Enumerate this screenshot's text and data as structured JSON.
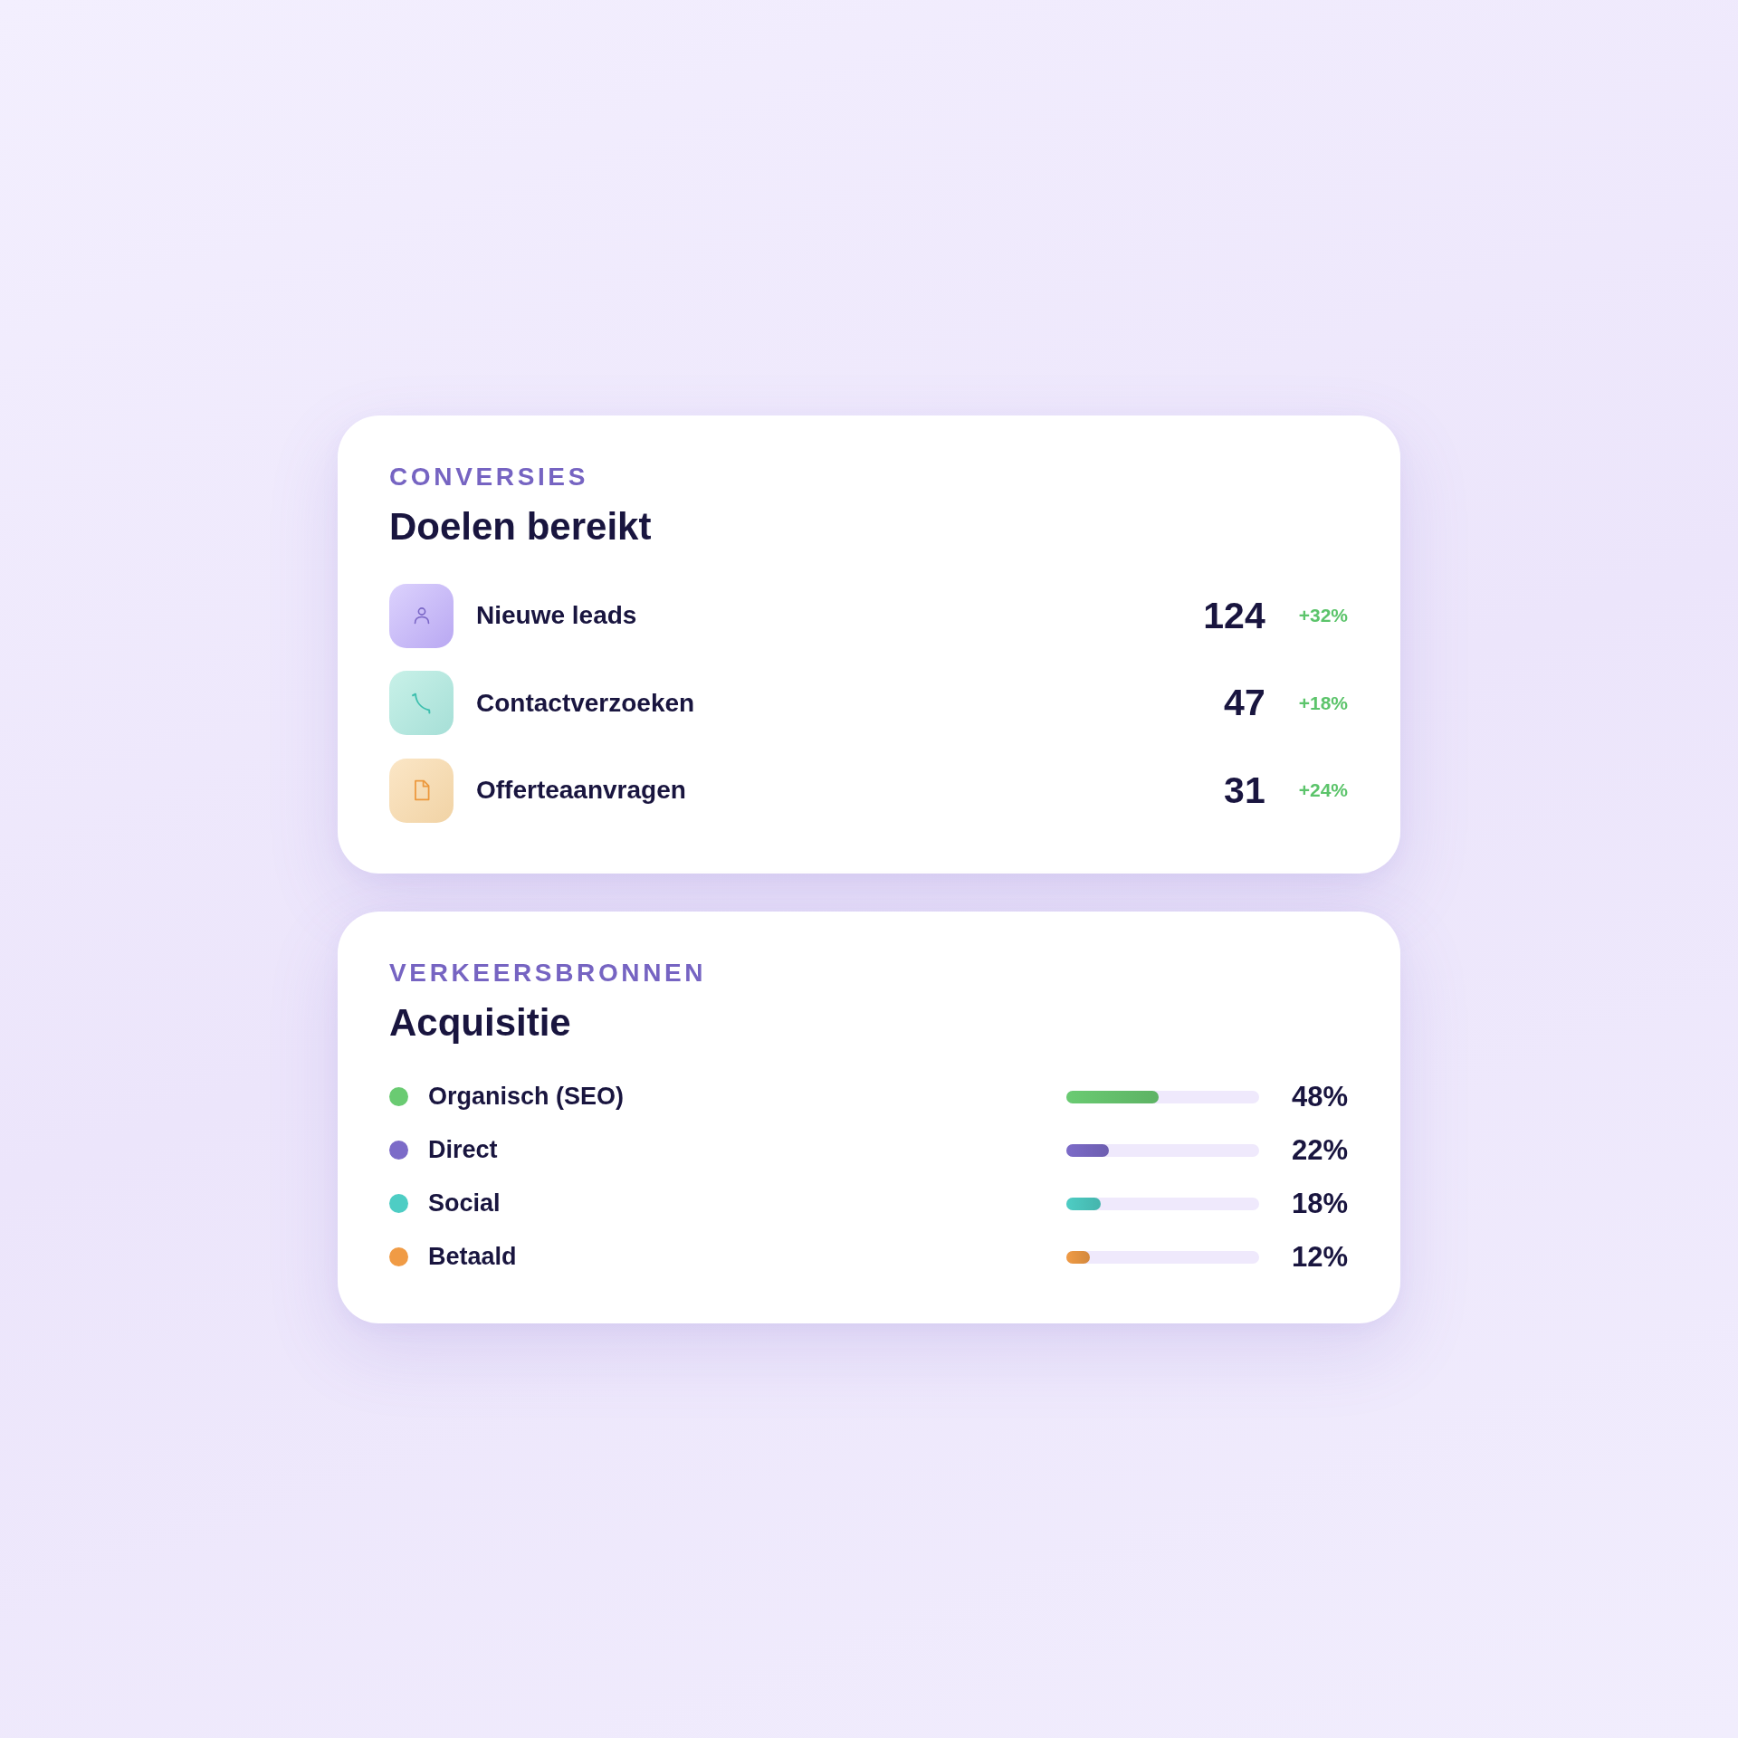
{
  "conversions": {
    "eyebrow": "CONVERSIES",
    "title": "Doelen bereikt",
    "items": [
      {
        "kind": "user",
        "label": "Nieuwe leads",
        "value": "124",
        "change": "+32%"
      },
      {
        "kind": "phone",
        "label": "Contactverzoeken",
        "value": "47",
        "change": "+18%"
      },
      {
        "kind": "file",
        "label": "Offerteaanvragen",
        "value": "31",
        "change": "+24%"
      }
    ]
  },
  "sources": {
    "eyebrow": "VERKEERSBRONNEN",
    "title": "Acquisitie",
    "items": [
      {
        "label": "Organisch (SEO)",
        "color": "#6acb72",
        "level": 0.48,
        "share": "48%"
      },
      {
        "label": "Direct",
        "color": "#7c6bc8",
        "level": 0.22,
        "share": "22%"
      },
      {
        "label": "Social",
        "color": "#4ecdc4",
        "level": 0.18,
        "share": "18%"
      },
      {
        "label": "Betaald",
        "color": "#f09b45",
        "level": 0.12,
        "share": "12%"
      }
    ]
  }
}
